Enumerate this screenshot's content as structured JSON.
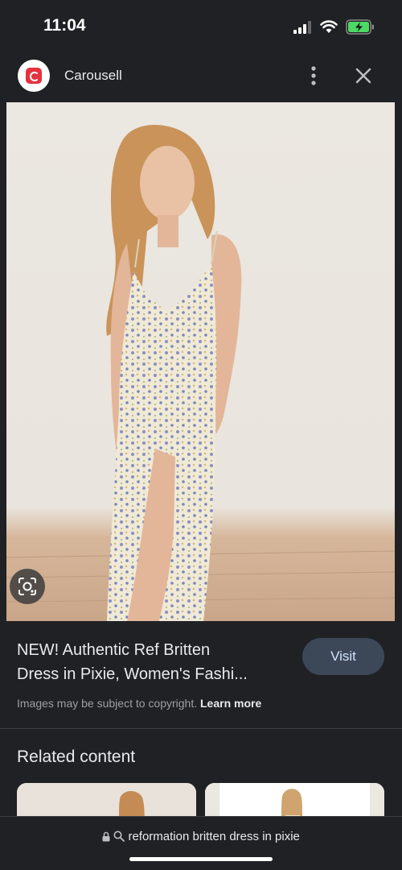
{
  "status_bar": {
    "time": "11:04",
    "battery_color": "#4cd964"
  },
  "header": {
    "app_name": "Carousell",
    "logo_color": "#e5323e",
    "icons": [
      "more-vert-icon",
      "close-icon"
    ]
  },
  "product": {
    "title_line1": "NEW! Authentic Ref Britten",
    "title_line2": "Dress in Pixie, Women's Fashi...",
    "visit_label": "Visit",
    "copyright_text": "Images may be subject to copyright.",
    "learn_more_label": "Learn more"
  },
  "related": {
    "heading": "Related content"
  },
  "search_bar": {
    "query": "reformation britten dress in pixie"
  },
  "colors": {
    "background": "#202124",
    "visit_button": "#3c4858",
    "visit_text": "#d2e3fc"
  }
}
